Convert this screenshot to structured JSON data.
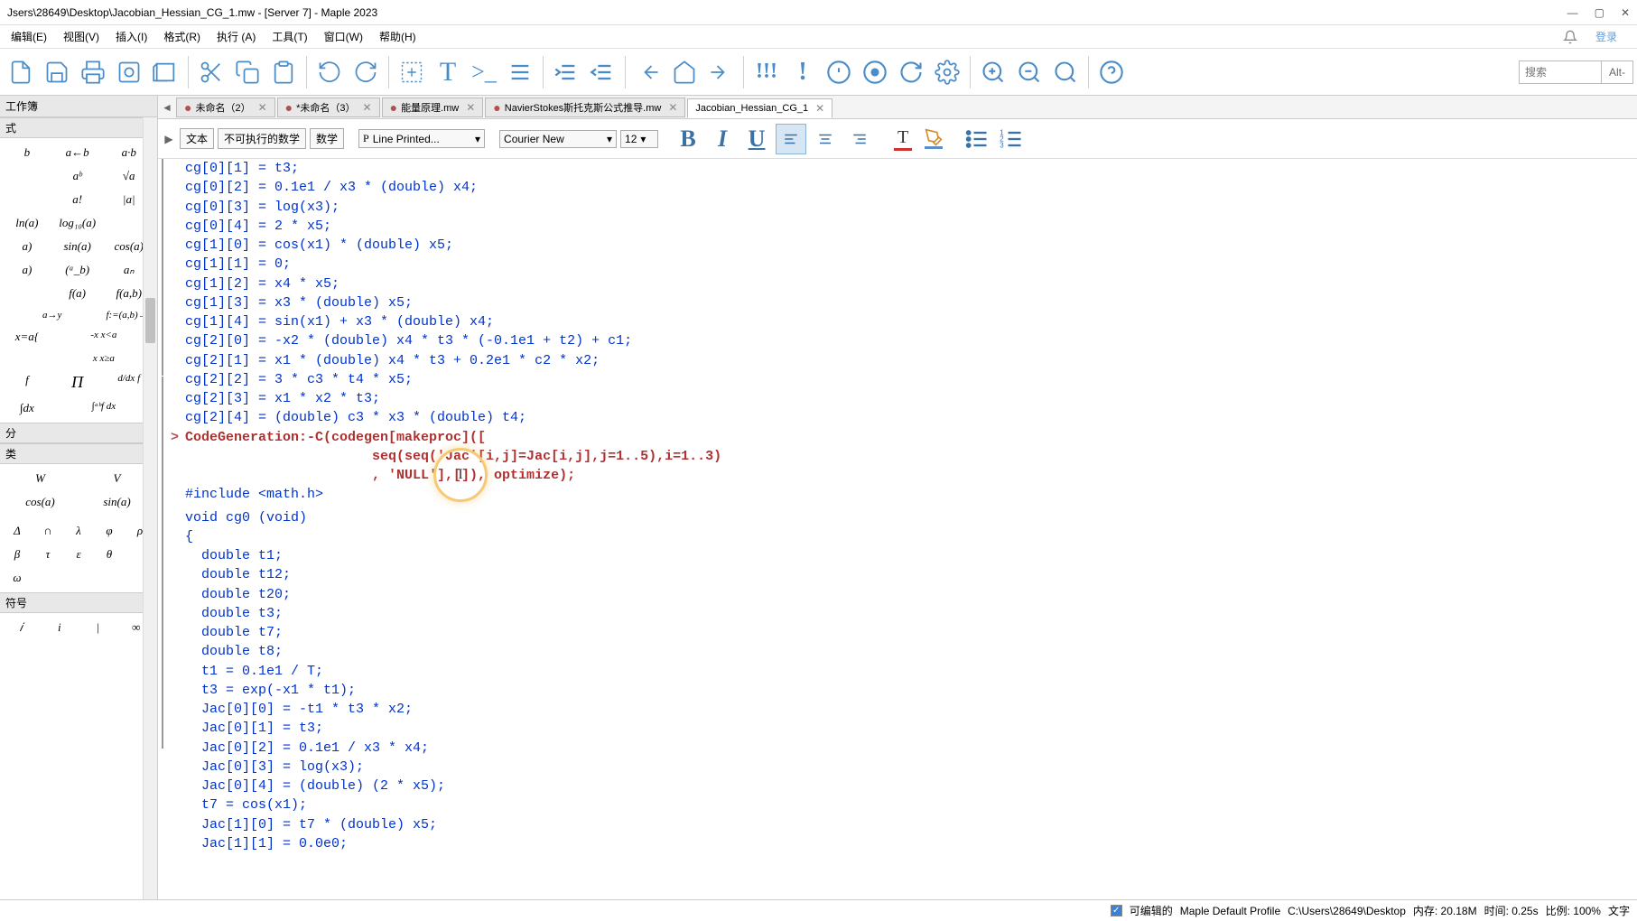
{
  "titlebar": {
    "text": "Jsers\\28649\\Desktop\\Jacobian_Hessian_CG_1.mw - [Server 7] - Maple 2023"
  },
  "menubar": {
    "items": [
      "编辑(E)",
      "视图(V)",
      "插入(I)",
      "格式(R)",
      "执行 (A)",
      "工具(T)",
      "窗口(W)",
      "帮助(H)"
    ],
    "login": "登录"
  },
  "toolbar": {
    "search_placeholder": "搜索",
    "search_hint": "Alt-"
  },
  "leftpanel": {
    "header": "工作簿",
    "section_formula": "式",
    "section_integral": "分",
    "section_class": "类",
    "section_symbol": "符号",
    "palette_rows": [
      [
        "b",
        "a←b",
        "a·b"
      ],
      [
        "",
        "aᵇ",
        "√a"
      ],
      [
        "",
        "a!",
        "|a|"
      ],
      [
        "ln(a)",
        "log₁₀(a)",
        ""
      ],
      [
        "a)",
        "sin(a)",
        "cos(a)"
      ],
      [
        "a)",
        "(ᵃ_b)",
        "aₙ"
      ],
      [
        "",
        "f(a)",
        "f(a,b)"
      ],
      [
        "a→y",
        "f:=(a,b)→z",
        ""
      ],
      [
        "x=a{",
        "-x  x<a",
        ""
      ],
      [
        "",
        "x  x≥a",
        ""
      ],
      [
        "f",
        "Π",
        "d/dx f"
      ],
      [
        "∫dx",
        "∫ᵃᵇf dx",
        ""
      ]
    ],
    "wv_row": [
      "W",
      "V"
    ],
    "trig_row": [
      "cos(a)",
      "sin(a)"
    ],
    "greek1": [
      "Δ",
      "∩",
      "λ",
      "φ",
      "ρ"
    ],
    "greek2": [
      "β",
      "τ",
      "ε",
      "θ"
    ],
    "greek3": [
      "ω"
    ],
    "sym_row": [
      "𝑖",
      "i",
      "|",
      "∞"
    ]
  },
  "tabs": {
    "items": [
      {
        "label": "未命名（2）",
        "modified": true,
        "active": false
      },
      {
        "label": "*未命名（3）",
        "modified": true,
        "active": false
      },
      {
        "label": "能量原理.mw",
        "modified": true,
        "active": false
      },
      {
        "label": "NavierStokes斯托克斯公式推导.mw",
        "modified": true,
        "active": false
      },
      {
        "label": "Jacobian_Hessian_CG_1",
        "modified": false,
        "active": true
      }
    ]
  },
  "context": {
    "btn_text": "文本",
    "btn_nonexec": "不可执行的数学",
    "btn_math": "数学",
    "style": "Line Printed...",
    "font": "Courier New",
    "size": "12"
  },
  "code": {
    "lines": [
      "cg[0][1] = t3;",
      "cg[0][2] = 0.1e1 / x3 * (double) x4;",
      "cg[0][3] = log(x3);",
      "cg[0][4] = 2 * x5;",
      "cg[1][0] = cos(x1) * (double) x5;",
      "cg[1][1] = 0;",
      "cg[1][2] = x4 * x5;",
      "cg[1][3] = x3 * (double) x5;",
      "cg[1][4] = sin(x1) + x3 * (double) x4;",
      "cg[2][0] = -x2 * (double) x4 * t3 * (-0.1e1 + t2) + c1;",
      "cg[2][1] = x1 * (double) x4 * t3 + 0.2e1 * c2 * x2;",
      "cg[2][2] = 3 * c3 * t4 * x5;",
      "cg[2][3] = x1 * x2 * t3;",
      "cg[2][4] = (double) c3 * x3 * (double) t4;"
    ],
    "command": {
      "l1": "CodeGeneration:-C(codegen[makeproc]([",
      "l2": "                       seq(seq('Jac'[i,j]=Jac[i,j],j=1..5),i=1..3)",
      "l3": "                       , 'NULL'],[]), optimize);"
    },
    "output": [
      "#include <math.h>",
      "",
      "void cg0 (void)",
      "{",
      "  double t1;",
      "  double t12;",
      "  double t20;",
      "  double t3;",
      "  double t7;",
      "  double t8;",
      "  t1 = 0.1e1 / T;",
      "  t3 = exp(-x1 * t1);",
      "  Jac[0][0] = -t1 * t3 * x2;",
      "  Jac[0][1] = t3;",
      "  Jac[0][2] = 0.1e1 / x3 * x4;",
      "  Jac[0][3] = log(x3);",
      "  Jac[0][4] = (double) (2 * x5);",
      "  t7 = cos(x1);",
      "  Jac[1][0] = t7 * (double) x5;",
      "  Jac[1][1] = 0.0e0;"
    ]
  },
  "statusbar": {
    "editable": "可编辑的",
    "profile": "Maple Default Profile",
    "path": "C:\\Users\\28649\\Desktop",
    "memory": "内存: 20.18M",
    "time": "时间: 0.25s",
    "ratio": "比例: 100%",
    "extra": "文字"
  }
}
